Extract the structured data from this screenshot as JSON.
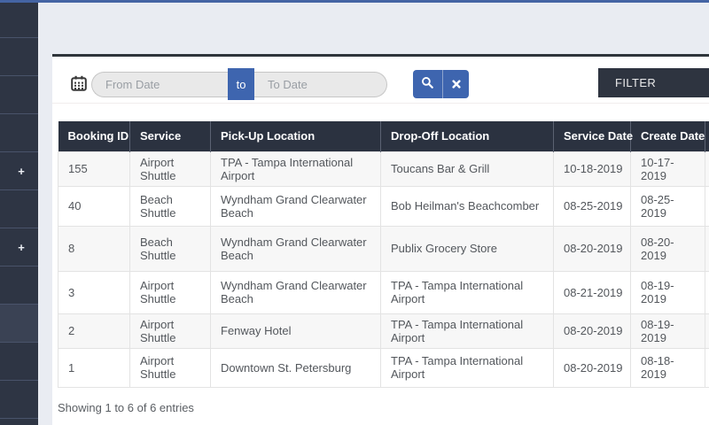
{
  "colors": {
    "topbar_blue": "#4464a4",
    "primary_blue": "#3e65af",
    "sidebar_navy": "#2e3544",
    "table_header_navy": "#2b3240",
    "filter_button_navy": "#2e3440",
    "card_top_border": "#2f353b"
  },
  "sidebar": {
    "plus_glyph": "+"
  },
  "filter_bar": {
    "from_date": {
      "value": "",
      "placeholder": "From Date"
    },
    "to_connector_label": "to",
    "to_date": {
      "value": "",
      "placeholder": "To Date"
    },
    "filter_button_label": "FILTER"
  },
  "table": {
    "columns": [
      "Booking ID",
      "Service",
      "Pick-Up Location",
      "Drop-Off Location",
      "Service Date",
      "Create Date",
      ""
    ],
    "rows": [
      [
        "155",
        "Airport Shuttle",
        "TPA - Tampa International Airport",
        "Toucans Bar & Grill",
        "10-18-2019",
        "10-17-2019",
        ""
      ],
      [
        "40",
        "Beach Shuttle",
        "Wyndham Grand Clearwater Beach",
        "Bob Heilman's Beachcomber",
        "08-25-2019",
        "08-25-2019",
        ""
      ],
      [
        "8",
        "Beach Shuttle",
        "Wyndham Grand Clearwater Beach",
        "Publix Grocery Store",
        "08-20-2019",
        "08-20-2019",
        ""
      ],
      [
        "3",
        "Airport Shuttle",
        "Wyndham Grand Clearwater Beach",
        "TPA - Tampa International Airport",
        "08-21-2019",
        "08-19-2019",
        ""
      ],
      [
        "2",
        "Airport Shuttle",
        "Fenway Hotel",
        "TPA - Tampa International Airport",
        "08-20-2019",
        "08-19-2019",
        ""
      ],
      [
        "1",
        "Airport Shuttle",
        "Downtown St. Petersburg",
        "TPA - Tampa International Airport",
        "08-20-2019",
        "08-18-2019",
        ""
      ]
    ]
  },
  "footer": {
    "entries_summary": "Showing 1 to 6 of 6 entries"
  }
}
